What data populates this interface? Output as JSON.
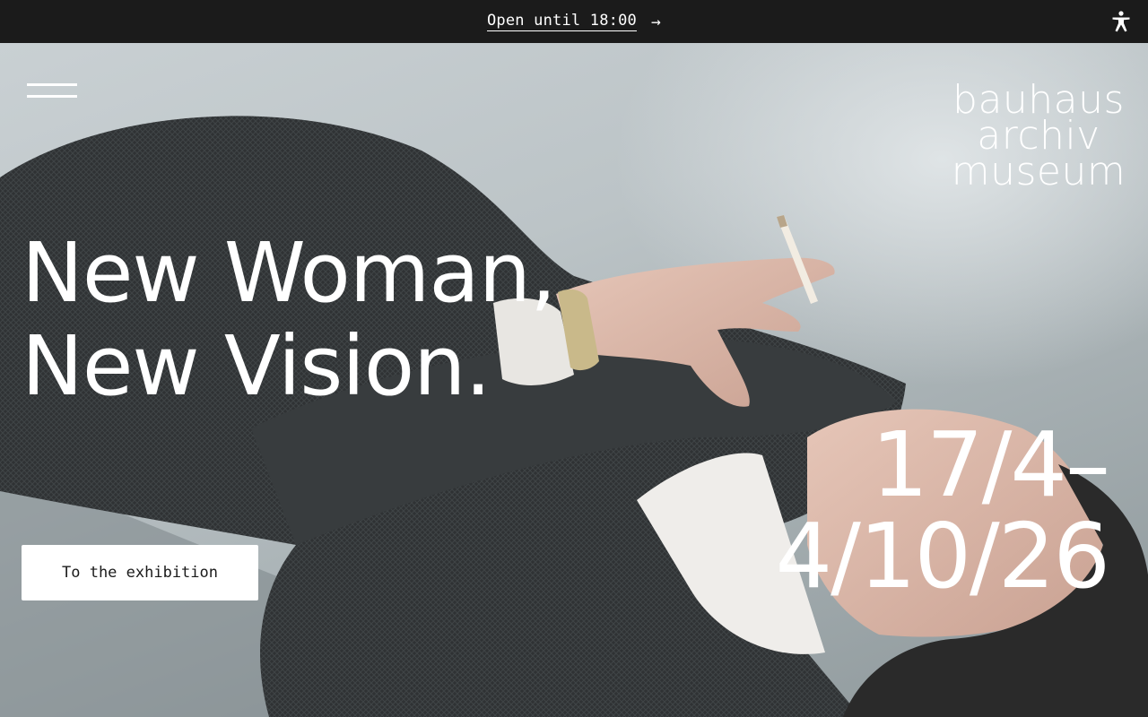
{
  "topbar": {
    "notice": "Open until 18:00",
    "arrow": "→",
    "accessibility_icon": "accessibility-person-icon"
  },
  "header": {
    "menu_icon": "hamburger-menu-icon",
    "logo": [
      "bauhaus",
      "archiv",
      "museum"
    ]
  },
  "hero": {
    "title_lines": [
      "New Woman,",
      "New Vision."
    ],
    "date_lines": [
      "17/4–",
      "4/10/26"
    ],
    "cta_label": "To the exhibition",
    "image": "woman-lying-in-tweed-coat-with-cigarette-photo"
  },
  "colors": {
    "topbar_bg": "#1b1b1b",
    "text_light": "#ffffff",
    "cta_bg": "#ffffff",
    "cta_text": "#1b1b1b"
  }
}
